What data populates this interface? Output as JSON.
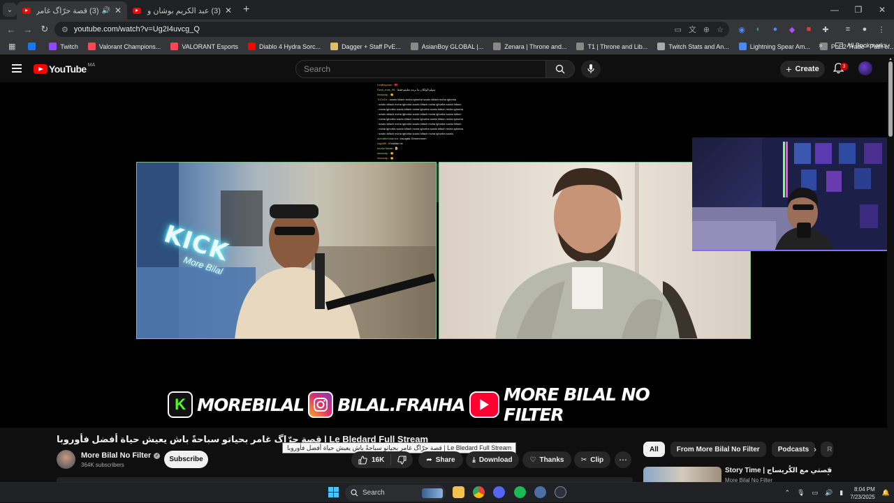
{
  "browser": {
    "tabs": [
      {
        "title": "(3) قصة حرّاگ غامر بحياتو سباحةً باش يعيش حياة أفضل فأوروبا",
        "active": true
      },
      {
        "title": "(3) عبد الكريم بوشان وتفاصيل حياته",
        "active": false
      }
    ],
    "url": "youtube.com/watch?v=Ug2I4uvcg_Q",
    "bookmarks": [
      {
        "label": "",
        "color": "#1877f2"
      },
      {
        "label": "Twitch",
        "color": "#9146ff"
      },
      {
        "label": "Valorant Champions...",
        "color": "#ff4655"
      },
      {
        "label": "VALORANT Esports",
        "color": "#ff4655"
      },
      {
        "label": "Diablo 4 Hydra Sorc...",
        "color": "#ff0000"
      },
      {
        "label": "Dagger + Staff PvE...",
        "color": "#e0c060"
      },
      {
        "label": "AsianBoy GLOBAL |...",
        "color": "#888888"
      },
      {
        "label": "Zenara | Throne and...",
        "color": "#888888"
      },
      {
        "label": "T1 | Throne and Lib...",
        "color": "#888888"
      },
      {
        "label": "Twitch Stats and An...",
        "color": "#aaaaaa"
      },
      {
        "label": "Lightning Spear Am...",
        "color": "#4a8af4"
      },
      {
        "label": "PoE2 Trade - Path of...",
        "color": "#888888"
      }
    ],
    "all_bookmarks": "All Bookmarks"
  },
  "youtube": {
    "logo_text": "YouTube",
    "country_code": "MA",
    "search_placeholder": "Search",
    "create_label": "Create",
    "notification_count": "3"
  },
  "video": {
    "chat_lines": [
      {
        "name": "LeaBayman",
        "msg": "🇲🇦"
      },
      {
        "name": "Dzzk_mas_98",
        "msg": "سولو الولكان نتا برمة تعليقو فقط"
      },
      {
        "name": "imadodp",
        "msg": "👏"
      },
      {
        "name": "TriOzDz",
        "msg": "sowlo kifach mcha ighorba sowlo kifach mcha ighorba"
      },
      {
        "name": "",
        "msg": "sowlo kifach mcha ighorba sowlo kifach mcha ighorba sowlo kifach"
      },
      {
        "name": "",
        "msg": "mcha ighorba sowlo kifach mcha ighorba sowlo kifach mcha ighorba"
      },
      {
        "name": "",
        "msg": "sowlo kifach mcha ighorba sowlo kifach mcha ighorba sowlo kifach"
      },
      {
        "name": "",
        "msg": "mcha ighorba sowlo kifach mcha ighorba sowlo kifach mcha ighorba"
      },
      {
        "name": "",
        "msg": "sowlo kifach mcha ighorba sowlo kifach mcha ighorba sowlo kifach"
      },
      {
        "name": "",
        "msg": "mcha ighorba sowlo kifach mcha ighorba sowlo kifach mcha ighorba"
      },
      {
        "name": "",
        "msg": "sowlo kifach mcha ighorba sowlo kifach mcha ighorba sowlo"
      },
      {
        "name": "achrafbenhamza",
        "msg": "bsuqata Ghmmmmm"
      },
      {
        "name": "hajarfifi",
        "msg": "il habibe nti"
      },
      {
        "name": "tourkeTaaaa",
        "msg": "🍺"
      },
      {
        "name": "imadodp",
        "msg": "👏"
      },
      {
        "name": "imadodp",
        "msg": "👏"
      },
      {
        "name": "imadodp",
        "msg": "👏"
      },
      {
        "name": "imadodp",
        "msg": "👏"
      },
      {
        "name": "",
        "msg": "7ali to mo"
      },
      {
        "name": "achrafbenhamza",
        "msg": "ghmmmmm"
      }
    ],
    "cam_left_sign": "KICK",
    "cam_left_sub": "More Bilal",
    "banner": {
      "kick_letter": "K",
      "kick_handle": "MOREBILAL",
      "insta_handle": "BILAL.FRAIHA",
      "yt_handle": "MORE BILAL NO FILTER"
    }
  },
  "details": {
    "title": "قصة حرّاگ غامر بحياتو سباحةً باش يعيش حياة أفضل فأوروبا | Le Bledard Full Stream",
    "tooltip": "قصة حرّاگ غامر بحياتو سباحةً باش يعيش حياة أفضل فأوروبا | Le Bledard Full Stream",
    "channel_name": "More Bilal No Filter",
    "subscribers": "364K subscribers",
    "subscribe_label": "Subscribe",
    "likes": "16K",
    "share_label": "Share",
    "download_label": "Download",
    "thanks_label": "Thanks",
    "clip_label": "Clip"
  },
  "sidebar": {
    "chips": [
      "All",
      "From More Bilal No Filter",
      "Podcasts",
      "R"
    ],
    "rec_title": "Story Time | قصتي مع الكُريساج",
    "rec_channel": "More Bilal No Filter"
  },
  "taskbar": {
    "search_label": "Search",
    "time": "8:04 PM",
    "date": "7/23/2025"
  }
}
